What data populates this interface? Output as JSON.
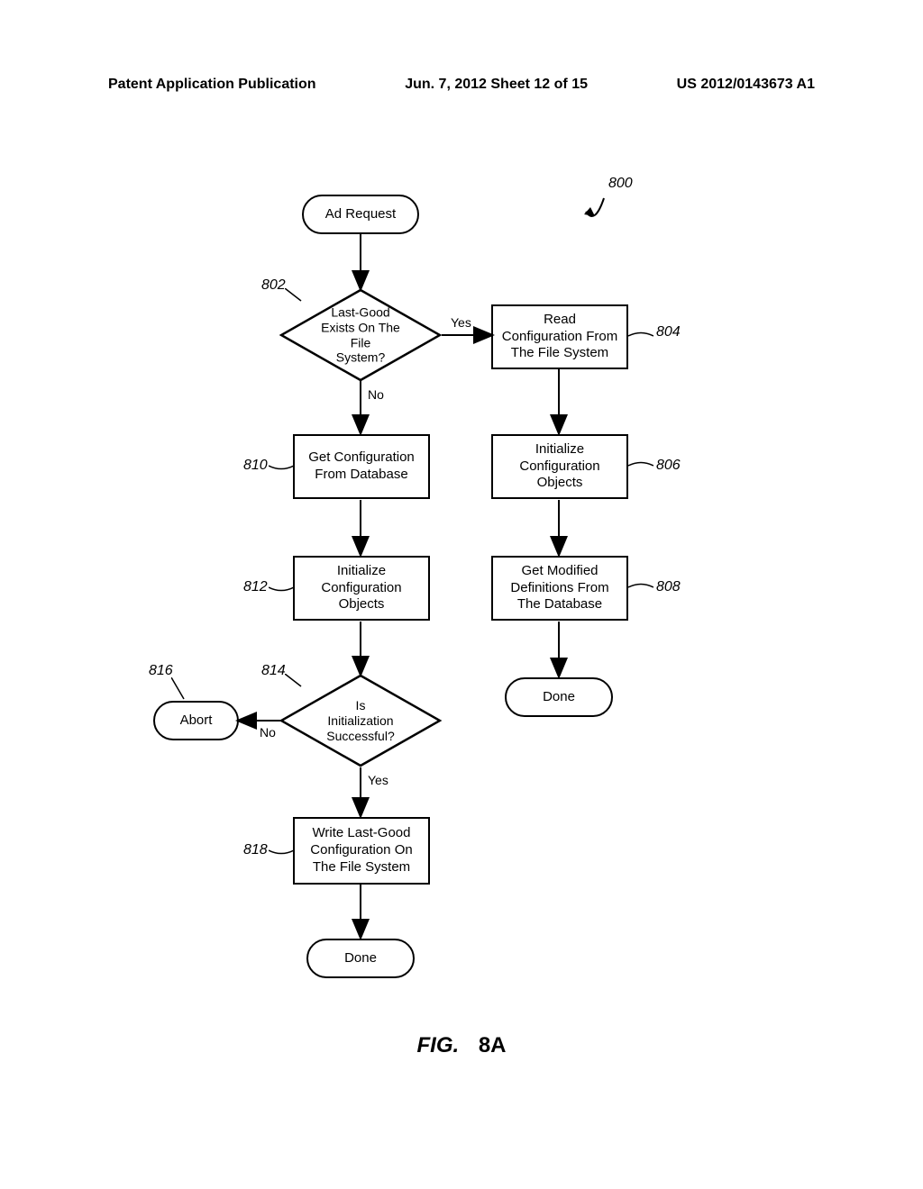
{
  "header": {
    "left": "Patent Application Publication",
    "center": "Jun. 7, 2012  Sheet 12 of 15",
    "right": "US 2012/0143673 A1"
  },
  "refs": {
    "r800": "800",
    "r802": "802",
    "r804": "804",
    "r806": "806",
    "r808": "808",
    "r810": "810",
    "r812": "812",
    "r814": "814",
    "r816": "816",
    "r818": "818"
  },
  "nodes": {
    "ad_request": "Ad Request",
    "dec802": "Last-Good\nExists On The File\nSystem?",
    "p804": "Read\nConfiguration From\nThe File System",
    "p806": "Initialize\nConfiguration\nObjects",
    "p808": "Get Modified\nDefinitions From\nThe Database",
    "done_right": "Done",
    "p810": "Get Configuration\nFrom Database",
    "p812": "Initialize\nConfiguration\nObjects",
    "dec814": "Is\nInitialization\nSuccessful?",
    "abort": "Abort",
    "p818": "Write Last-Good\nConfiguration On\nThe File System",
    "done_left": "Done"
  },
  "labels": {
    "yes1": "Yes",
    "no1": "No",
    "yes2": "Yes",
    "no2": "No"
  },
  "figure": {
    "prefix": "FIG.",
    "num": "8A"
  }
}
